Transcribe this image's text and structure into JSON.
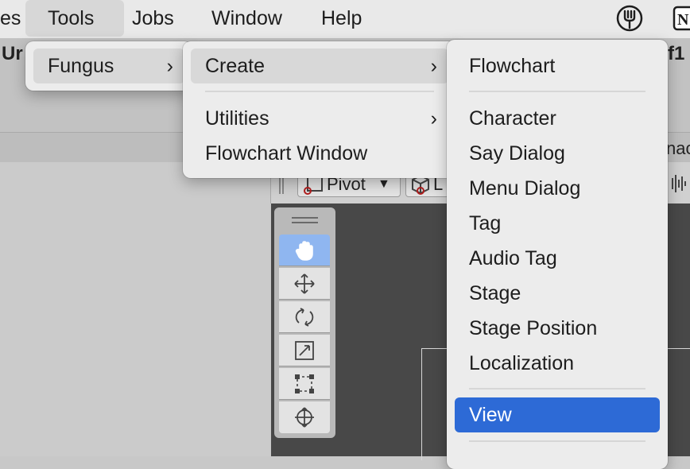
{
  "menubar": {
    "items": [
      {
        "label": "es"
      },
      {
        "label": "Tools"
      },
      {
        "label": "Jobs"
      },
      {
        "label": "Window"
      },
      {
        "label": "Help"
      }
    ],
    "right_icons": [
      "fork-icon",
      "notion-icon"
    ],
    "notion_letter": "N"
  },
  "background": {
    "title_left": "Ur",
    "title_right": "f1",
    "tab_fragment": "nac",
    "pivot_label": "Pivot",
    "local_fragment": "L"
  },
  "menu_tools": {
    "items": [
      {
        "label": "Fungus",
        "submenu": true
      }
    ]
  },
  "menu_fungus": {
    "items": [
      {
        "label": "Create",
        "submenu": true
      },
      {
        "label": "Utilities",
        "submenu": true
      },
      {
        "label": "Flowchart Window",
        "submenu": false
      }
    ]
  },
  "menu_create": {
    "items": [
      {
        "label": "Flowchart"
      },
      {
        "label": "Character"
      },
      {
        "label": "Say Dialog"
      },
      {
        "label": "Menu Dialog"
      },
      {
        "label": "Tag"
      },
      {
        "label": "Audio Tag"
      },
      {
        "label": "Stage"
      },
      {
        "label": "Stage Position"
      },
      {
        "label": "Localization"
      },
      {
        "label": "View"
      }
    ],
    "selected": "View"
  },
  "colors": {
    "highlight": "#2d6ad6",
    "tool_selected": "#8fb6f0"
  }
}
